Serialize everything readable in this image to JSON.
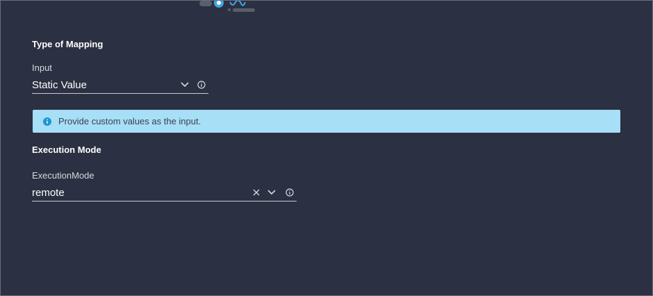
{
  "mapping": {
    "section_title": "Type of Mapping",
    "input_label": "Input",
    "input_value": "Static Value"
  },
  "banner": {
    "text": "Provide custom values as the input.",
    "icon": "info-circle-icon",
    "background": "#a7dff7",
    "icon_color": "#1f95d1"
  },
  "execution": {
    "section_title": "Execution Mode",
    "field_label": "ExecutionMode",
    "field_value": "remote"
  },
  "colors": {
    "background": "#2b3042",
    "accent": "#3ba6e8"
  }
}
